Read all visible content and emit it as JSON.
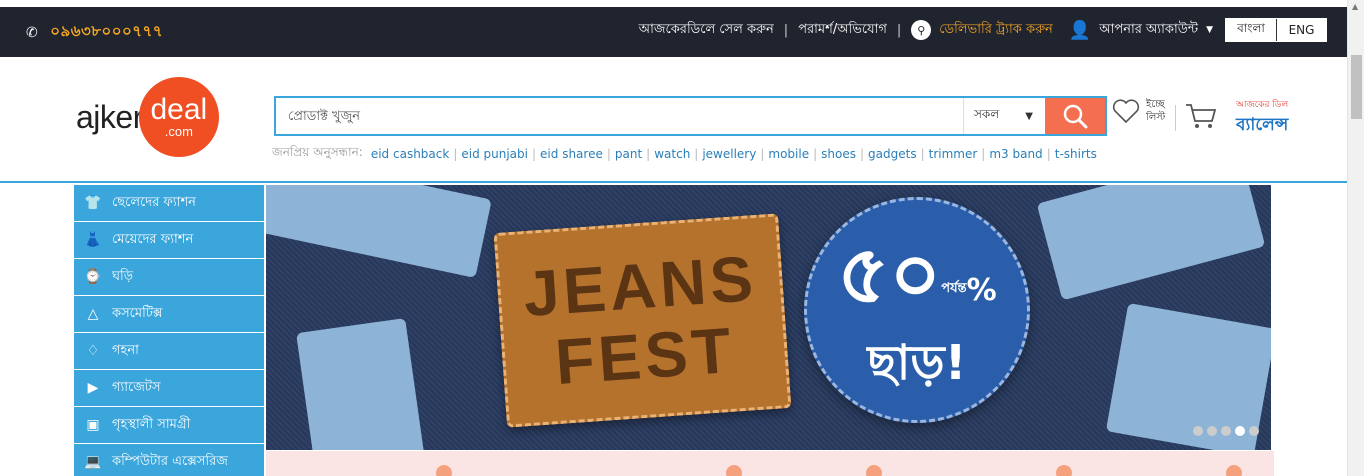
{
  "topbar": {
    "phone": "০৯৬৩৮০০০৭৭৭",
    "links": {
      "sell": "আজকেরডিলে সেল করুন",
      "feedback": "পরামর্শ/অভিযোগ",
      "track": "ডেলিভারি ট্র্যাক করুন",
      "account": "আপনার অ্যাকাউন্ট"
    },
    "lang_bn": "বাংলা",
    "lang_en": "ENG"
  },
  "header": {
    "logo_ajker": "ajker",
    "logo_deal": "deal",
    "logo_com": ".com",
    "search_placeholder": "প্রোডাক্ট খুজুন",
    "category_selected": "সকল",
    "popular_label": "জনপ্রিয় অনুসন্ধান:",
    "popular_keywords": [
      "eid cashback",
      "eid punjabi",
      "eid sharee",
      "pant",
      "watch",
      "jewellery",
      "mobile",
      "shoes",
      "gadgets",
      "trimmer",
      "m3 band",
      "t-shirts"
    ],
    "wishlist_label_1": "ইচ্ছে",
    "wishlist_label_2": "লিস্ট",
    "balance_top": "আজকের ডিল",
    "balance_main": "ব্যালেন্স"
  },
  "sidebar": {
    "items": [
      {
        "label": "ছেলেদের ফ্যাশন",
        "icon": "tshirt-icon"
      },
      {
        "label": "মেয়েদের ফ্যাশন",
        "icon": "dress-icon"
      },
      {
        "label": "ঘড়ি",
        "icon": "watch-icon"
      },
      {
        "label": "কসমেটিক্স",
        "icon": "cosmetics-icon"
      },
      {
        "label": "গহনা",
        "icon": "jewellery-icon"
      },
      {
        "label": "গ্যাজেটস",
        "icon": "gadget-icon"
      },
      {
        "label": "গৃহস্থালী সামগ্রী",
        "icon": "household-icon"
      },
      {
        "label": "কম্পিউটার এক্সেসরিজ",
        "icon": "computer-icon"
      }
    ]
  },
  "banner": {
    "line1": "JEANS",
    "line2": "FEST",
    "discount": "৫০",
    "upto": "পর্যন্ত",
    "percent": "%",
    "off": "ছাড়!",
    "slides_total": 5,
    "slide_active": 3
  },
  "colors": {
    "topbar_bg": "#20242f",
    "accent_orange": "#f5a623",
    "brand_red": "#f04e23",
    "sidebar_blue": "#3aa6dc"
  }
}
